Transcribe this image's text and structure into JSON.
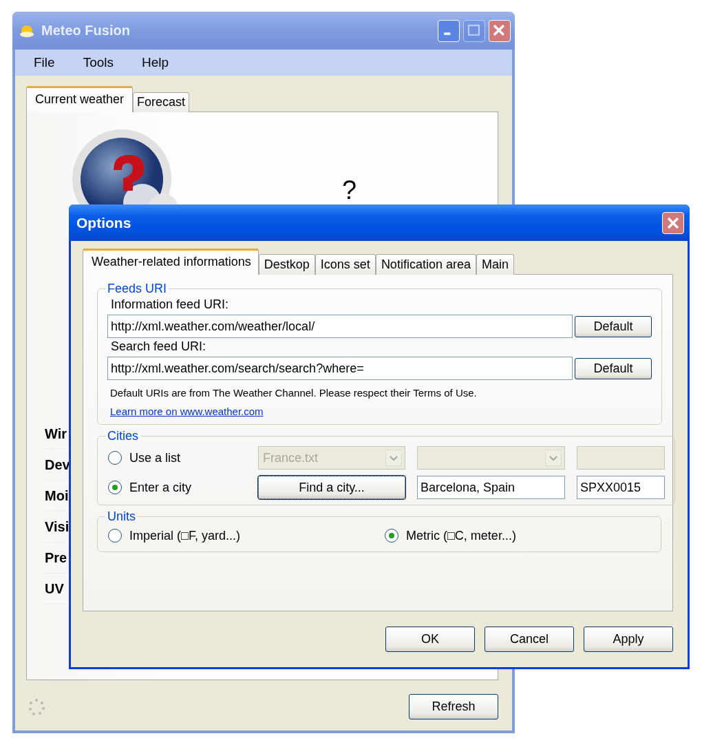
{
  "main_window": {
    "title": "Meteo Fusion",
    "title_buttons": [
      {
        "kind": "minimize",
        "disabled": false
      },
      {
        "kind": "maximize",
        "disabled": true
      },
      {
        "kind": "close",
        "disabled": false
      }
    ],
    "menu": [
      "File",
      "Tools",
      "Help"
    ],
    "tabs": [
      {
        "label": "Current weather",
        "selected": true
      },
      {
        "label": "Forecast",
        "selected": false
      }
    ],
    "condition": "?",
    "details": [
      "Wir",
      "Dev",
      "Moi",
      "Visi",
      "Pre",
      "UV"
    ],
    "refresh_button": "Refresh"
  },
  "options_dialog": {
    "title": "Options",
    "tabs": [
      {
        "label": "Weather-related informations",
        "selected": true
      },
      {
        "label": "Destkop",
        "selected": false
      },
      {
        "label": "Icons set",
        "selected": false
      },
      {
        "label": "Notification area",
        "selected": false
      },
      {
        "label": "Main",
        "selected": false
      }
    ],
    "feeds": {
      "legend": "Feeds URI",
      "fields": [
        {
          "label": "Information feed URI:",
          "value": "http://xml.weather.com/weather/local/",
          "button": "Default"
        },
        {
          "label": "Search feed URI:",
          "value": "http://xml.weather.com/search/search?where=",
          "button": "Default"
        }
      ],
      "note": "Default URIs are from The Weather Channel. Please respect their Terms of Use.",
      "link": "Learn more on www.weather.com"
    },
    "cities": {
      "legend": "Cities",
      "options": [
        {
          "label": "Use a list",
          "selected": false,
          "controls": [
            {
              "kind": "combo",
              "value": "France.txt",
              "disabled": true
            },
            {
              "kind": "combo",
              "disabled": true
            },
            {
              "kind": "text",
              "disabled": true
            }
          ]
        },
        {
          "label": "Enter a city",
          "selected": true,
          "controls": [
            {
              "kind": "button",
              "value": "Find a city...",
              "disabled": false
            },
            {
              "kind": "text",
              "value": "Barcelona, Spain",
              "disabled": false
            },
            {
              "kind": "text",
              "value": "SPXX0015",
              "disabled": false
            }
          ]
        }
      ]
    },
    "units": {
      "legend": "Units",
      "options": [
        {
          "label": "Imperial (□F, yard...)",
          "selected": false
        },
        {
          "label": "Metric (□C, meter...)",
          "selected": true
        }
      ]
    },
    "buttons": [
      "OK",
      "Cancel",
      "Apply"
    ]
  }
}
